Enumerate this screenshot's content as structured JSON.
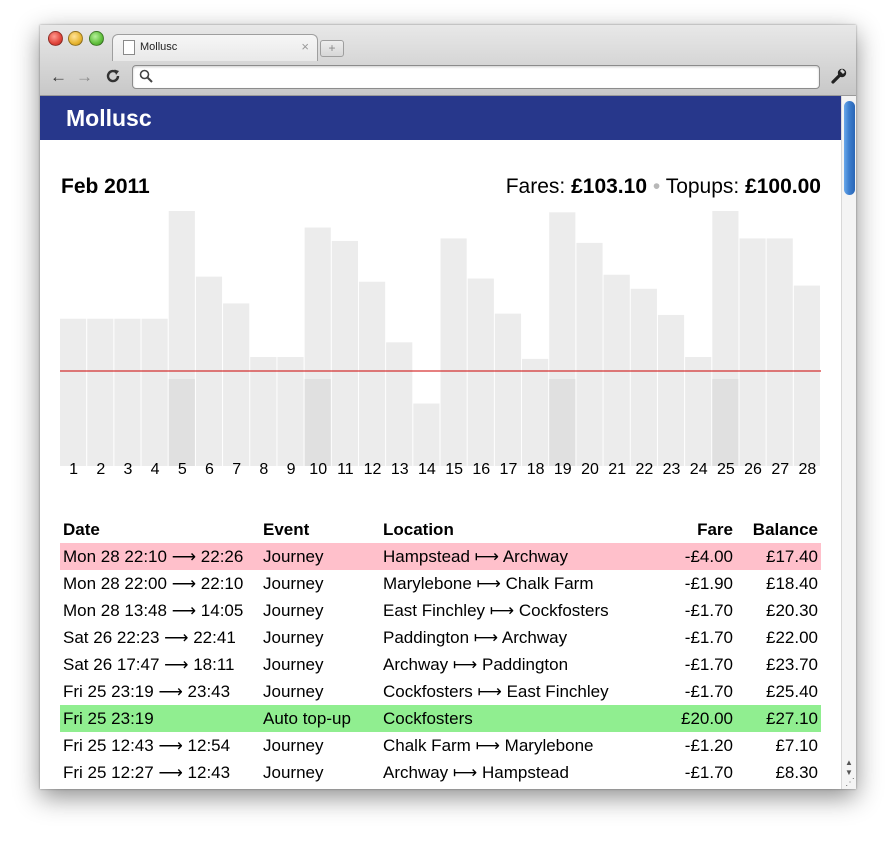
{
  "browser": {
    "tab_title": "Mollusc",
    "tab_close": "×",
    "new_tab": "+",
    "back": "←",
    "forward": "→",
    "reload": "C",
    "url_value": "",
    "icons": [
      "page-icon",
      "search-icon",
      "wrench-icon"
    ]
  },
  "app": {
    "title": "Mollusc",
    "header_color": "#27378b"
  },
  "summary": {
    "month": "Feb 2011",
    "fares_label": "Fares: ",
    "fares_value": "£103.10",
    "separator": "•",
    "topups_label": "Topups: ",
    "topups_value": "£100.00"
  },
  "chart_data": {
    "type": "bar",
    "categories": [
      "1",
      "2",
      "3",
      "4",
      "5",
      "6",
      "7",
      "8",
      "9",
      "10",
      "11",
      "12",
      "13",
      "14",
      "15",
      "16",
      "17",
      "18",
      "19",
      "20",
      "21",
      "22",
      "23",
      "24",
      "25",
      "26",
      "27",
      "28"
    ],
    "series": [
      {
        "values": [
          23.1,
          23.1,
          23.1,
          23.1,
          40.0,
          29.7,
          25.5,
          17.1,
          17.1,
          37.4,
          35.3,
          28.9,
          19.4,
          9.8,
          35.7,
          29.4,
          23.9,
          16.8,
          39.8,
          35.0,
          30.0,
          27.8,
          23.7,
          17.1,
          40.0,
          35.7,
          35.7,
          28.3
        ]
      }
    ],
    "highlight_days": [
      "5",
      "10",
      "19",
      "25"
    ],
    "reference_line": 14.9,
    "ylim": [
      0,
      40
    ],
    "bar_color": "#ececec",
    "highlight_color": "#e0e0e0",
    "reference_line_color": "#cc0000"
  },
  "table": {
    "headers": {
      "date": "Date",
      "event": "Event",
      "location": "Location",
      "fare": "Fare",
      "balance": "Balance"
    },
    "rows": [
      {
        "date": "Mon 28 22:10 ⟶ 22:26",
        "event": "Journey",
        "location": "Hampstead ⟼ Archway",
        "fare": "-£4.00",
        "balance": "£17.40",
        "highlight": "red"
      },
      {
        "date": "Mon 28 22:00 ⟶ 22:10",
        "event": "Journey",
        "location": "Marylebone ⟼ Chalk Farm",
        "fare": "-£1.90",
        "balance": "£18.40",
        "highlight": ""
      },
      {
        "date": "Mon 28 13:48 ⟶ 14:05",
        "event": "Journey",
        "location": "East Finchley ⟼ Cockfosters",
        "fare": "-£1.70",
        "balance": "£20.30",
        "highlight": ""
      },
      {
        "date": "Sat 26 22:23 ⟶ 22:41",
        "event": "Journey",
        "location": "Paddington ⟼ Archway",
        "fare": "-£1.70",
        "balance": "£22.00",
        "highlight": ""
      },
      {
        "date": "Sat 26 17:47 ⟶ 18:11",
        "event": "Journey",
        "location": "Archway ⟼ Paddington",
        "fare": "-£1.70",
        "balance": "£23.70",
        "highlight": ""
      },
      {
        "date": "Fri 25 23:19 ⟶ 23:43",
        "event": "Journey",
        "location": "Cockfosters ⟼ East Finchley",
        "fare": "-£1.70",
        "balance": "£25.40",
        "highlight": ""
      },
      {
        "date": "Fri 25 23:19",
        "event": "Auto top-up",
        "location": "Cockfosters",
        "fare": "£20.00",
        "balance": "£27.10",
        "highlight": "green"
      },
      {
        "date": "Fri 25 12:43 ⟶ 12:54",
        "event": "Journey",
        "location": "Chalk Farm ⟼ Marylebone",
        "fare": "-£1.20",
        "balance": "£7.10",
        "highlight": ""
      },
      {
        "date": "Fri 25 12:27 ⟶ 12:43",
        "event": "Journey",
        "location": "Archway ⟼ Hampstead",
        "fare": "-£1.70",
        "balance": "£8.30",
        "highlight": ""
      }
    ]
  }
}
